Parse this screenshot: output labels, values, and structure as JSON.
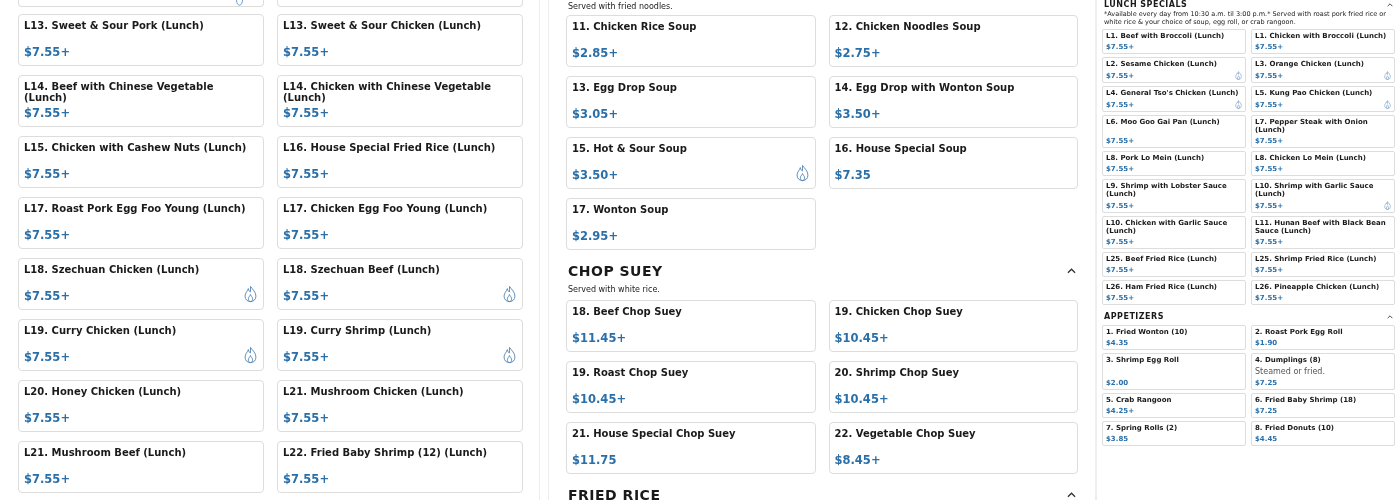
{
  "panels": [
    {
      "kind": "full",
      "sections": [
        {
          "items": [
            {
              "kind": "partial",
              "spicy": true
            },
            {
              "kind": "partial",
              "spicy": false
            },
            {
              "kind": "card",
              "name": "L13. Sweet & Sour Pork (Lunch)",
              "price": "$7.55+",
              "spicy": false
            },
            {
              "kind": "card",
              "name": "L13. Sweet & Sour Chicken (Lunch)",
              "price": "$7.55+",
              "spicy": false
            },
            {
              "kind": "card",
              "name": "L14. Beef with Chinese Vegetable (Lunch)",
              "price": "$7.55+",
              "spicy": false
            },
            {
              "kind": "card",
              "name": "L14. Chicken with Chinese Vegetable (Lunch)",
              "price": "$7.55+",
              "spicy": false
            },
            {
              "kind": "card",
              "name": "L15. Chicken with Cashew Nuts (Lunch)",
              "price": "$7.55+",
              "spicy": false
            },
            {
              "kind": "card",
              "name": "L16. House Special Fried Rice (Lunch)",
              "price": "$7.55+",
              "spicy": false
            },
            {
              "kind": "card",
              "name": "L17. Roast Pork Egg Foo Young (Lunch)",
              "price": "$7.55+",
              "spicy": false
            },
            {
              "kind": "card",
              "name": "L17. Chicken Egg Foo Young (Lunch)",
              "price": "$7.55+",
              "spicy": false
            },
            {
              "kind": "card",
              "name": "L18. Szechuan Chicken (Lunch)",
              "price": "$7.55+",
              "spicy": true
            },
            {
              "kind": "card",
              "name": "L18. Szechuan Beef (Lunch)",
              "price": "$7.55+",
              "spicy": true
            },
            {
              "kind": "card",
              "name": "L19. Curry Chicken (Lunch)",
              "price": "$7.55+",
              "spicy": true
            },
            {
              "kind": "card",
              "name": "L19. Curry Shrimp (Lunch)",
              "price": "$7.55+",
              "spicy": true
            },
            {
              "kind": "card",
              "name": "L20. Honey Chicken (Lunch)",
              "price": "$7.55+",
              "spicy": false
            },
            {
              "kind": "card",
              "name": "L21. Mushroom Chicken (Lunch)",
              "price": "$7.55+",
              "spicy": false
            },
            {
              "kind": "card",
              "name": "L21. Mushroom Beef (Lunch)",
              "price": "$7.55+",
              "spicy": false
            },
            {
              "kind": "card",
              "name": "L22. Fried Baby Shrimp (12) (Lunch)",
              "price": "$7.55+",
              "spicy": false
            }
          ]
        }
      ]
    },
    {
      "kind": "full",
      "sections": [
        {
          "description": "Served with fried noodles.",
          "items": [
            {
              "kind": "card",
              "name": "11. Chicken Rice Soup",
              "price": "$2.85+",
              "spicy": false
            },
            {
              "kind": "card",
              "name": "12. Chicken Noodles Soup",
              "price": "$2.75+",
              "spicy": false
            },
            {
              "kind": "card",
              "name": "13. Egg Drop Soup",
              "price": "$3.05+",
              "spicy": false
            },
            {
              "kind": "card",
              "name": "14. Egg Drop with Wonton Soup",
              "price": "$3.50+",
              "spicy": false
            },
            {
              "kind": "card",
              "name": "15. Hot & Sour Soup",
              "price": "$3.50+",
              "spicy": true
            },
            {
              "kind": "card",
              "name": "16. House Special Soup",
              "price": "$7.35",
              "spicy": false
            },
            {
              "kind": "card",
              "name": "17. Wonton Soup",
              "price": "$2.95+",
              "spicy": false
            }
          ]
        },
        {
          "title": "CHOP SUEY",
          "expanded": true,
          "description": "Served with white rice.",
          "items": [
            {
              "kind": "card",
              "name": "18. Beef Chop Suey",
              "price": "$11.45+",
              "spicy": false
            },
            {
              "kind": "card",
              "name": "19. Chicken Chop Suey",
              "price": "$10.45+",
              "spicy": false
            },
            {
              "kind": "card",
              "name": "19. Roast Chop Suey",
              "price": "$10.45+",
              "spicy": false
            },
            {
              "kind": "card",
              "name": "20. Shrimp Chop Suey",
              "price": "$10.45+",
              "spicy": false
            },
            {
              "kind": "card",
              "name": "21. House Special Chop Suey",
              "price": "$11.75",
              "spicy": false
            },
            {
              "kind": "card",
              "name": "22. Vegetable Chop Suey",
              "price": "$8.45+",
              "spicy": false
            }
          ]
        },
        {
          "title": "FRIED RICE",
          "expanded": true
        }
      ]
    },
    {
      "kind": "compact",
      "sections": [
        {
          "title": "LUNCH SPECIALS",
          "expanded": true,
          "description": "*Available every day from 10:30 a.m. til 3:00 p.m.* Served with roast pork fried rice or white rice & your choice of soup, egg roll, or crab rangoon.",
          "items": [
            {
              "kind": "card",
              "name": "L1. Beef with Broccoli (Lunch)",
              "price": "$7.55+",
              "spicy": false
            },
            {
              "kind": "card",
              "name": "L1. Chicken with Broccoli (Lunch)",
              "price": "$7.55+",
              "spicy": false
            },
            {
              "kind": "card",
              "name": "L2. Sesame Chicken (Lunch)",
              "price": "$7.55+",
              "spicy": true
            },
            {
              "kind": "card",
              "name": "L3. Orange Chicken (Lunch)",
              "price": "$7.55+",
              "spicy": true
            },
            {
              "kind": "card",
              "name": "L4. General Tso's Chicken (Lunch)",
              "price": "$7.55+",
              "spicy": true
            },
            {
              "kind": "card",
              "name": "L5. Kung Pao Chicken (Lunch)",
              "price": "$7.55+",
              "spicy": true
            },
            {
              "kind": "card",
              "name": "L6. Moo Goo Gai Pan (Lunch)",
              "price": "$7.55+",
              "spicy": false
            },
            {
              "kind": "card",
              "name": "L7. Pepper Steak with Onion (Lunch)",
              "price": "$7.55+",
              "spicy": false
            },
            {
              "kind": "card",
              "name": "L8. Pork Lo Mein (Lunch)",
              "price": "$7.55+",
              "spicy": false
            },
            {
              "kind": "card",
              "name": "L8. Chicken Lo Mein (Lunch)",
              "price": "$7.55+",
              "spicy": false
            },
            {
              "kind": "card",
              "name": "L9. Shrimp with Lobster Sauce (Lunch)",
              "price": "$7.55+",
              "spicy": false
            },
            {
              "kind": "card",
              "name": "L10. Shrimp with Garlic Sauce (Lunch)",
              "price": "$7.55+",
              "spicy": true
            },
            {
              "kind": "card",
              "name": "L10. Chicken with Garlic Sauce (Lunch)",
              "price": "$7.55+",
              "spicy": false
            },
            {
              "kind": "card",
              "name": "L11. Hunan Beef with Black Bean Sauce (Lunch)",
              "price": "$7.55+",
              "spicy": false
            },
            {
              "kind": "card",
              "name": "L25. Beef Fried Rice (Lunch)",
              "price": "$7.55+",
              "spicy": false
            },
            {
              "kind": "card",
              "name": "L25. Shrimp Fried Rice (Lunch)",
              "price": "$7.55+",
              "spicy": false
            },
            {
              "kind": "card",
              "name": "L26. Ham Fried Rice (Lunch)",
              "price": "$7.55+",
              "spicy": false
            },
            {
              "kind": "card",
              "name": "L26. Pineapple Chicken (Lunch)",
              "price": "$7.55+",
              "spicy": false
            }
          ]
        },
        {
          "title": "APPETIZERS",
          "expanded": true,
          "items": [
            {
              "kind": "card",
              "name": "1. Fried Wonton (10)",
              "price": "$4.35",
              "spicy": false
            },
            {
              "kind": "card",
              "name": "2. Roast Pork Egg Roll",
              "price": "$1.90",
              "spicy": false
            },
            {
              "kind": "card",
              "name": "3. Shrimp Egg Roll",
              "price": "$2.00",
              "spicy": false
            },
            {
              "kind": "card",
              "name": "4. Dumplings (8)",
              "description": "Steamed or fried.",
              "price": "$7.25",
              "spicy": false
            },
            {
              "kind": "card",
              "name": "5. Crab Rangoon",
              "price": "$4.25+",
              "spicy": false
            },
            {
              "kind": "card",
              "name": "6. Fried Baby Shrimp (18)",
              "price": "$7.25",
              "spicy": false
            },
            {
              "kind": "card",
              "name": "7. Spring Rolls (2)",
              "price": "$3.85",
              "spicy": false
            },
            {
              "kind": "card",
              "name": "8. Fried Donuts (10)",
              "price": "$4.45",
              "spicy": false
            }
          ]
        }
      ]
    }
  ]
}
